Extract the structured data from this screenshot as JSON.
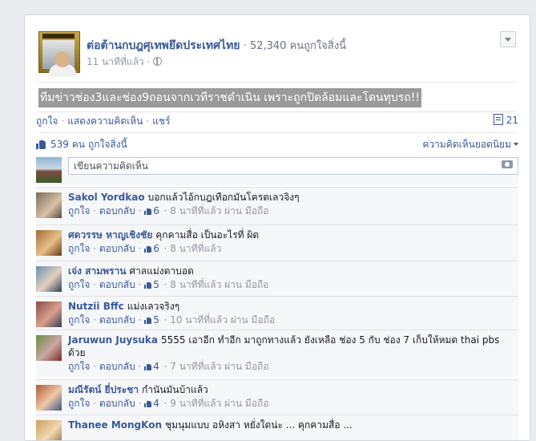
{
  "post": {
    "page_name": "ต่อต้านกบฎศุเทพยึดประเทศไทย",
    "separator": "·",
    "page_likes": "52,340 คนถูกใจสิ่งนี้",
    "time": "11 นาทีที่แล้ว ·",
    "text": "ทีมข่าวช่อง3และช่อง9ถอนจากเวทีราชดำเนิน เพราะถูกปิดล้อมและโดนทุบรถ!!"
  },
  "actions": {
    "like": "ถูกใจ",
    "comment": "แสดงความคิดเห็น",
    "share": "แชร์",
    "dot": "·",
    "comment_count": "21"
  },
  "likes_summary": {
    "count": "539 คน",
    "label": "ถูกใจสิ่งนี้",
    "top_comments": "ความคิดเห็นยอดนิยม"
  },
  "compose": {
    "placeholder": "เขียนความคิดเห็น"
  },
  "comments": [
    {
      "name": "Sakol Yordkao",
      "text": "บอกแล้วไอ้กบฎเทือกมันโครตเลวจิงๆ",
      "like": "ถูกใจ",
      "reply": "ตอบกลับ",
      "likes": "6",
      "meta": "8 นาทีที่แล้ว ผ่าน มือถือ"
    },
    {
      "name": "ศดวรรษ หาญเชิงชัย",
      "text": "คุกคามสื่อ เป็นอะไรที่ ผิด",
      "like": "ถูกใจ",
      "reply": "ตอบกลับ",
      "likes": "6",
      "meta": "8 นาทีที่แล้ว"
    },
    {
      "name": "เจ่ง สามพราน",
      "text": "ศาลแม่งตาบอด",
      "like": "ถูกใจ",
      "reply": "ตอบกลับ",
      "likes": "5",
      "meta": "8 นาทีที่แล้ว ผ่าน มือถือ"
    },
    {
      "name": "Nutzii Bffc",
      "text": "แม่งเลวจริงๆ",
      "like": "ถูกใจ",
      "reply": "ตอบกลับ",
      "likes": "5",
      "meta": "10 นาทีที่แล้ว ผ่าน มือถือ"
    },
    {
      "name": "Jaruwun Juysuka",
      "text": "5555 เอาอีก ทำอีก มาถูกทางแล้ว ยังเหลือ ช่อง 5 กับ ช่อง 7 เก็บให้หมด thai pbs ด้วย",
      "like": "ถูกใจ",
      "reply": "ตอบกลับ",
      "likes": "4",
      "meta": "7 นาทีที่แล้ว ผ่าน มือถือ"
    },
    {
      "name": "มณีรัตน์ ยี่ประชา",
      "text": "กำนันมันบ้าแล้ว",
      "like": "ถูกใจ",
      "reply": "ตอบกลับ",
      "likes": "4",
      "meta": "9 นาทีที่แล้ว ผ่าน มือถือ"
    },
    {
      "name": "Thanee MongKon",
      "text": "ชุมนุมแบบ อหิงสา หยั่งใดน่ะ ... คุกคามสื่อ ...",
      "like": "",
      "reply": "",
      "likes": "",
      "meta": ""
    }
  ],
  "colors": {
    "link": "#3b5998",
    "meta": "#9197a3",
    "background": "#e9ebee",
    "comment_bg": "#f6f7f9"
  }
}
